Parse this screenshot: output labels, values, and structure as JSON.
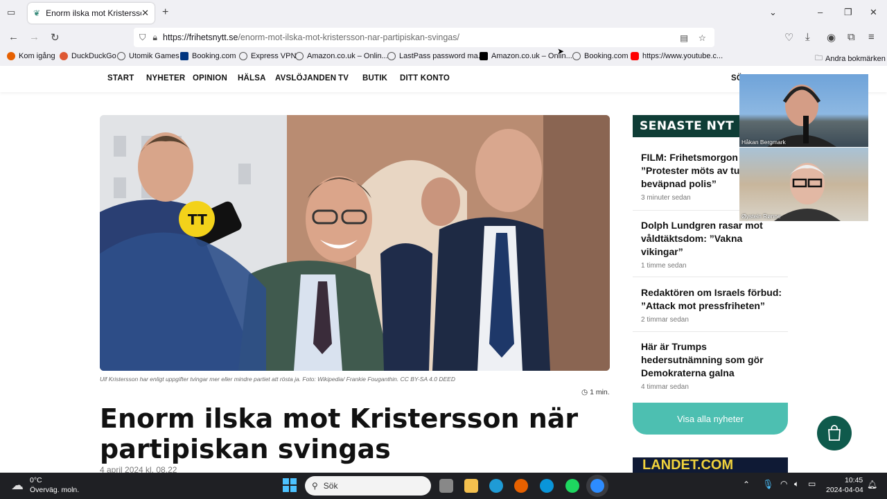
{
  "browser": {
    "tab_title": "Enorm ilska mot Kristersson när",
    "url_host": "https://frihetsnytt.se",
    "url_path": "/enorm-mot-ilska-mot-kristersson-nar-partipiskan-svingas/",
    "bookmarks": [
      "Kom igång",
      "DuckDuckGo",
      "Utomik Games",
      "Booking.com",
      "Express VPN",
      "Amazon.co.uk – Onlin...",
      "LastPass password ma...",
      "Amazon.co.uk – Onlin...",
      "Booking.com",
      "https://www.youtube.c..."
    ],
    "other_bookmarks": "Andra bokmärken"
  },
  "site": {
    "menu": [
      "START",
      "NYHETER",
      "OPINION",
      "HÄLSA",
      "AVSLÖJANDEN",
      "TV",
      "BUTIK",
      "DITT KONTO"
    ],
    "search_partial": "SÖ"
  },
  "article": {
    "caption": "Ulf Kristersson har enligt uppgifter tvingar mer eller mindre partiet att rösta ja. Foto: Wikipedia/ Frankie Fouganthin. CC BY-SA 4.0 DEED",
    "read_time": "1 min.",
    "headline": "Enorm ilska mot Kristersson när partipiskan svingas",
    "date": "4 april 2024 kl. 08.22",
    "mic_logo": "TT"
  },
  "sidebar": {
    "heading": "SENASTE NYT",
    "items": [
      {
        "title": "FILM: Frihetsmorgon – ”Protester möts av tungt beväpnad polis”",
        "time": "3 minuter sedan"
      },
      {
        "title": "Dolph Lundgren rasar mot våldtäktsdom: ”Vakna vikingar”",
        "time": "1 timme sedan"
      },
      {
        "title": "Redaktören om Israels förbud: ”Attack mot pressfriheten”",
        "time": "2 timmar sedan"
      },
      {
        "title": "Här är Trumps hedersutnämning som gör Demokraterna galna",
        "time": "4 timmar sedan"
      }
    ],
    "all_news_label": "Visa alla nyheter",
    "banner_text": "LANDET.COM"
  },
  "video_call": {
    "participant_1": "Håkan Bergmark",
    "participant_2": "Øystein Rønne"
  },
  "taskbar": {
    "temperature": "0°C",
    "weather": "Överväg. moln.",
    "search_placeholder": "Sök",
    "time": "10:45",
    "date": "2024-04-04"
  }
}
